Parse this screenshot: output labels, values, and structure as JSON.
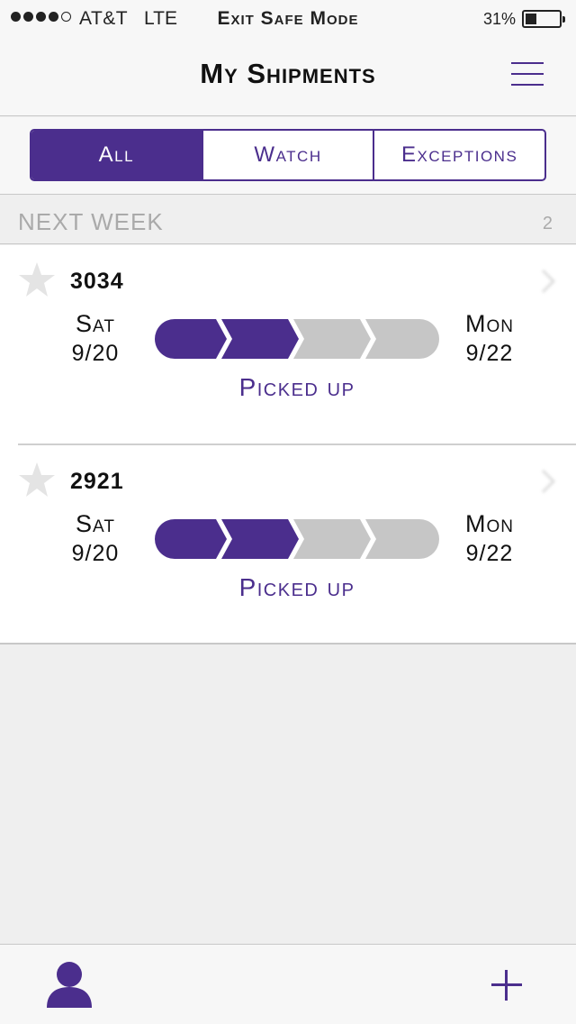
{
  "status_bar": {
    "carrier": "AT&T",
    "network": "LTE",
    "center_text": "Exit Safe Mode",
    "battery_percent": "31%",
    "signal_strength_bars": 4,
    "signal_total_bars": 5,
    "battery_level": 0.31
  },
  "nav": {
    "title": "My Shipments",
    "menu_icon": "hamburger-menu-icon"
  },
  "segments": [
    {
      "label": "All",
      "active": true
    },
    {
      "label": "Watch",
      "active": false
    },
    {
      "label": "Exceptions",
      "active": false
    }
  ],
  "section": {
    "title": "NEXT WEEK",
    "count": "2"
  },
  "shipments": [
    {
      "id": "3034",
      "tracking": "",
      "ship_day": "Sat",
      "ship_date": "9/20",
      "delivery_day": "Mon",
      "delivery_date": "9/22",
      "status": "Picked up",
      "progress_steps_done": 2,
      "progress_steps_total": 4
    },
    {
      "id": "2921",
      "tracking": "",
      "ship_day": "Sat",
      "ship_date": "9/20",
      "delivery_day": "Mon",
      "delivery_date": "9/22",
      "status": "Picked up",
      "progress_steps_done": 2,
      "progress_steps_total": 4
    }
  ],
  "tab_bar": {
    "profile_icon": "profile-icon",
    "add_icon": "plus-icon"
  },
  "colors": {
    "accent": "#4b2e8d",
    "inactive_step": "#c6c6c6",
    "muted_text": "#aaaaaa",
    "background": "#efefef"
  }
}
